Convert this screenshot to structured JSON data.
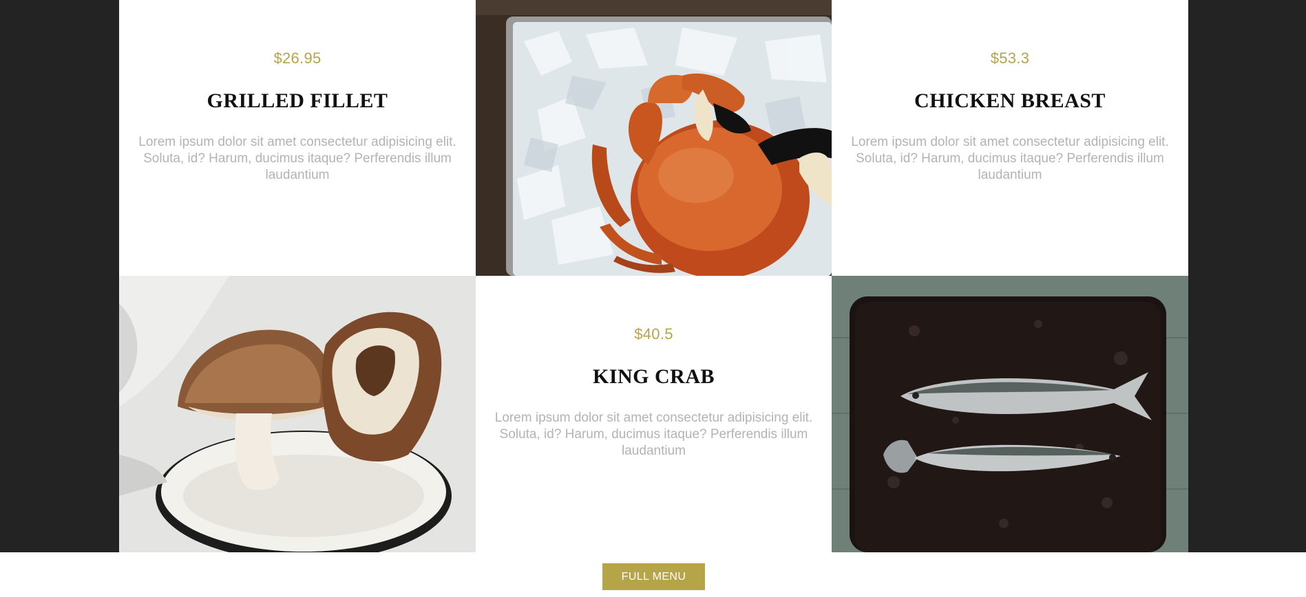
{
  "menu": {
    "items": [
      {
        "price": "$26.95",
        "name": "GRILLED FILLET",
        "description": "Lorem ipsum dolor sit amet consectetur adipisicing elit. Soluta, id? Harum, ducimus itaque? Perferendis illum laudantium"
      },
      {
        "price": "$53.3",
        "name": "CHICKEN BREAST",
        "description": "Lorem ipsum dolor sit amet consectetur adipisicing elit. Soluta, id? Harum, ducimus itaque? Perferendis illum laudantium"
      },
      {
        "price": "$40.5",
        "name": "KING CRAB",
        "description": "Lorem ipsum dolor sit amet consectetur adipisicing elit. Soluta, id? Harum, ducimus itaque? Perferendis illum laudantium"
      }
    ],
    "photos": [
      "crab on ice tray",
      "mushrooms in enamel bowl",
      "two mackerel fish on dark tray"
    ]
  },
  "footer": {
    "full_menu_label": "FULL MENU"
  },
  "colors": {
    "accent": "#b5a548",
    "background_band": "#232323",
    "card_bg": "#ffffff"
  }
}
